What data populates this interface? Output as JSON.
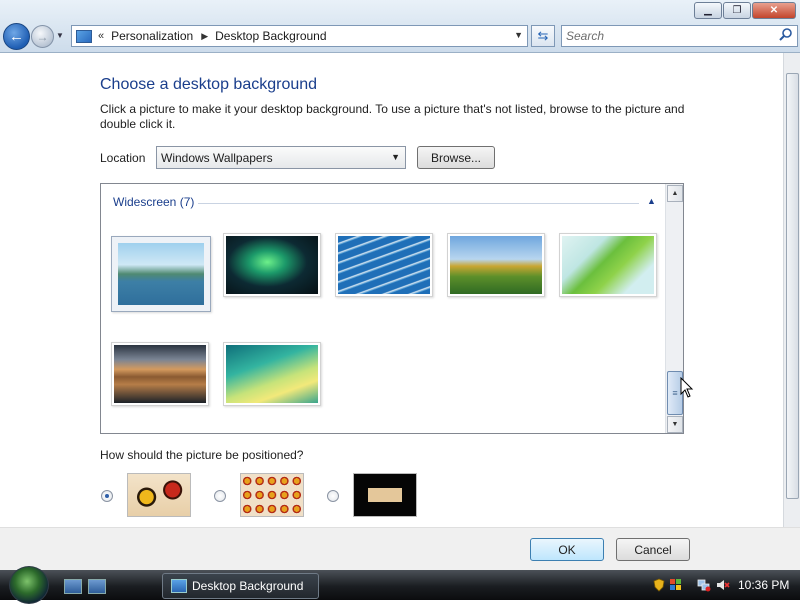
{
  "titlebar": {
    "buttons": [
      "minimize",
      "maximize",
      "close"
    ]
  },
  "nav": {
    "back_icon": "back-arrow-icon",
    "forward_icon": "forward-arrow-icon"
  },
  "address": {
    "overflow": "«",
    "crumbs": [
      "Personalization",
      "Desktop Background"
    ]
  },
  "search": {
    "placeholder": "Search"
  },
  "main": {
    "title": "Choose a desktop background",
    "intro": "Click a picture to make it your desktop background. To use a picture that's not listed, browse to the picture and double click it.",
    "location_label": "Location",
    "location_value": "Windows Wallpapers",
    "browse_label": "Browse...",
    "group_title": "Widescreen (7)",
    "thumbnails": [
      {
        "name": "mountain-lake",
        "selected": true
      },
      {
        "name": "aurora"
      },
      {
        "name": "fish-school"
      },
      {
        "name": "green-valley"
      },
      {
        "name": "palm-leaf"
      },
      {
        "name": "rock-reflection"
      },
      {
        "name": "vista-aurora"
      }
    ],
    "position_question": "How should the picture be positioned?",
    "position_options": [
      "fit-to-screen",
      "tile",
      "center"
    ],
    "position_selected": 0
  },
  "footer": {
    "ok_label": "OK",
    "cancel_label": "Cancel"
  },
  "taskbar": {
    "task_label": "Desktop Background",
    "clock": "10:36 PM"
  },
  "colors": {
    "heading": "#1a3e8c",
    "accent": "#2463b5"
  }
}
